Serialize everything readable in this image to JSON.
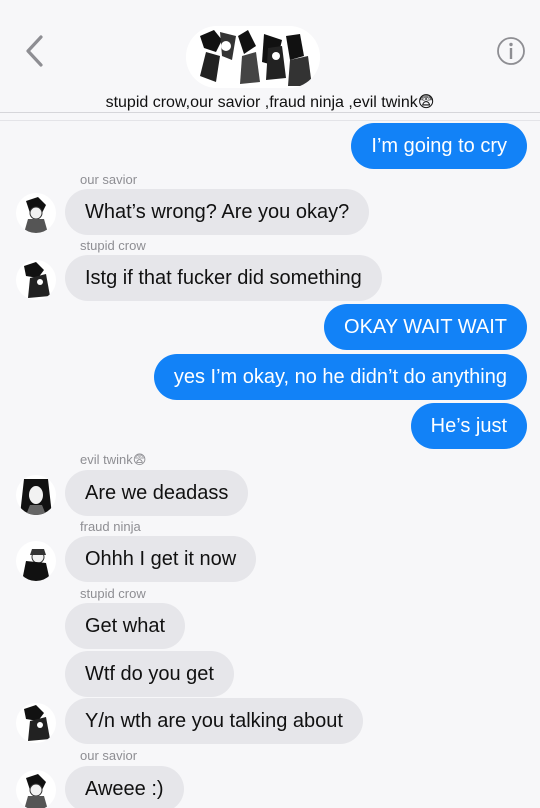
{
  "header": {
    "title": "stupid crow,our savior ,fraud ninja ,evil twink😨",
    "back_icon": "chevron-left-icon",
    "info_icon": "info-icon",
    "accent": "#1282f7"
  },
  "messages": [
    {
      "side": "out",
      "text": "I’m going to cry"
    },
    {
      "sender": "our savior"
    },
    {
      "side": "in",
      "text": "What’s wrong? Are you okay?"
    },
    {
      "sender": "stupid crow"
    },
    {
      "side": "in",
      "text": "Istg if that fucker did something"
    },
    {
      "side": "out",
      "text": "OKAY WAIT WAIT"
    },
    {
      "side": "out",
      "text": "yes I’m okay, no he didn’t do anything"
    },
    {
      "side": "out",
      "text": "He’s just"
    },
    {
      "sender": "evil twink😨"
    },
    {
      "side": "in",
      "text": "Are we deadass"
    },
    {
      "sender": "fraud ninja"
    },
    {
      "side": "in",
      "text": "Ohhh I get it now"
    },
    {
      "sender": "stupid crow"
    },
    {
      "side": "in",
      "text": "Get what"
    },
    {
      "side": "in",
      "text": "Wtf do you get"
    },
    {
      "side": "in",
      "text": "Y/n wth are you talking about"
    },
    {
      "sender": "our savior"
    },
    {
      "side": "in",
      "text": "Aweee :)"
    }
  ]
}
